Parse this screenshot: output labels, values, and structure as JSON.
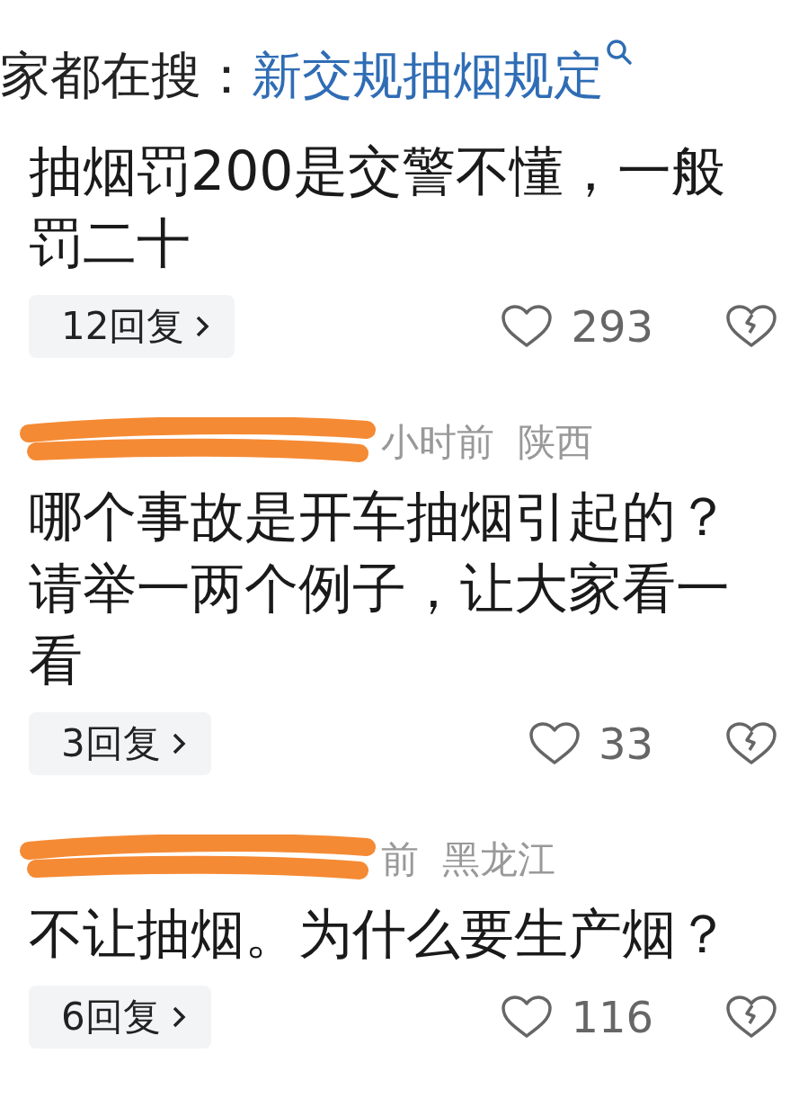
{
  "hot_search": {
    "label": "家都在搜：",
    "query": "新交规抽烟规定"
  },
  "comments": [
    {
      "text": "抽烟罚200是交警不懂，一般罚二十",
      "replies": "12回复",
      "likes": "293"
    },
    {
      "redacted": true,
      "time": "小时前",
      "location": "陕西",
      "text": "哪个事故是开车抽烟引起的？请举一两个例子，让大家看一看",
      "replies": "3回复",
      "likes": "33"
    },
    {
      "redacted": true,
      "time": "前",
      "location": "黑龙江",
      "text": "不让抽烟。为什么要生产烟？",
      "replies": "6回复",
      "likes": "116"
    }
  ]
}
